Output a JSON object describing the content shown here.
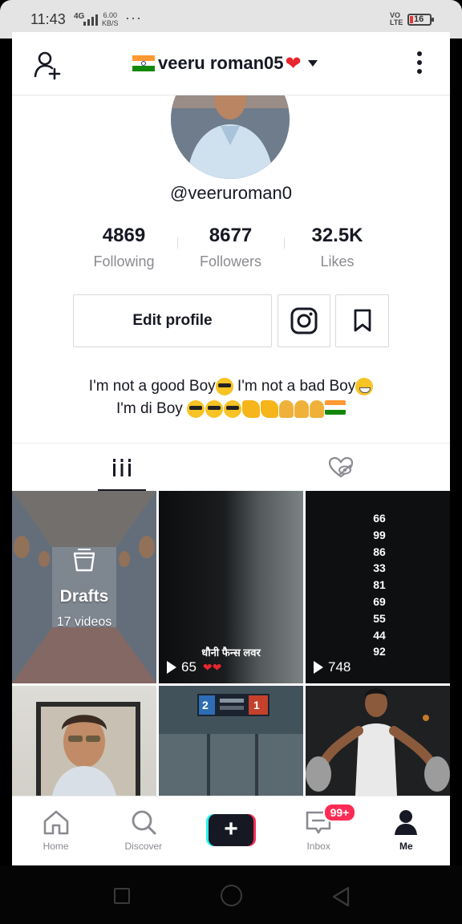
{
  "status_bar": {
    "time": "11:43",
    "network": "4G",
    "speed_value": "6.00",
    "speed_unit": "KB/S",
    "more": "···",
    "volte": "VO LTE",
    "battery": "16"
  },
  "header": {
    "title": "veeru roman05"
  },
  "profile": {
    "handle": "@veeruroman0",
    "stats": [
      {
        "value": "4869",
        "label": "Following"
      },
      {
        "value": "8677",
        "label": "Followers"
      },
      {
        "value": "32.5K",
        "label": "Likes"
      }
    ],
    "edit_label": "Edit profile",
    "bio_line1_a": "I'm not a good Boy",
    "bio_line1_b": " I'm not a bad Boy",
    "bio_line2": "I'm di Boy "
  },
  "grid": {
    "drafts_label": "Drafts",
    "drafts_count": "17 videos",
    "video2_caption": "धौनी फैन्स लवर",
    "video2_views": "65",
    "video3_numbers": [
      "66",
      "99",
      "86",
      "33",
      "81",
      "69",
      "55",
      "44",
      "92"
    ],
    "video3_views": "748",
    "video5_score_left": "2",
    "video5_score_right": "1"
  },
  "bottom_nav": {
    "home": "Home",
    "discover": "Discover",
    "create": "+",
    "inbox": "Inbox",
    "inbox_badge": "99+",
    "me": "Me"
  },
  "colors": {
    "accent_red": "#fe2c55",
    "accent_cyan": "#25f4ee",
    "text_primary": "#161823",
    "text_secondary": "#8a8b91"
  }
}
